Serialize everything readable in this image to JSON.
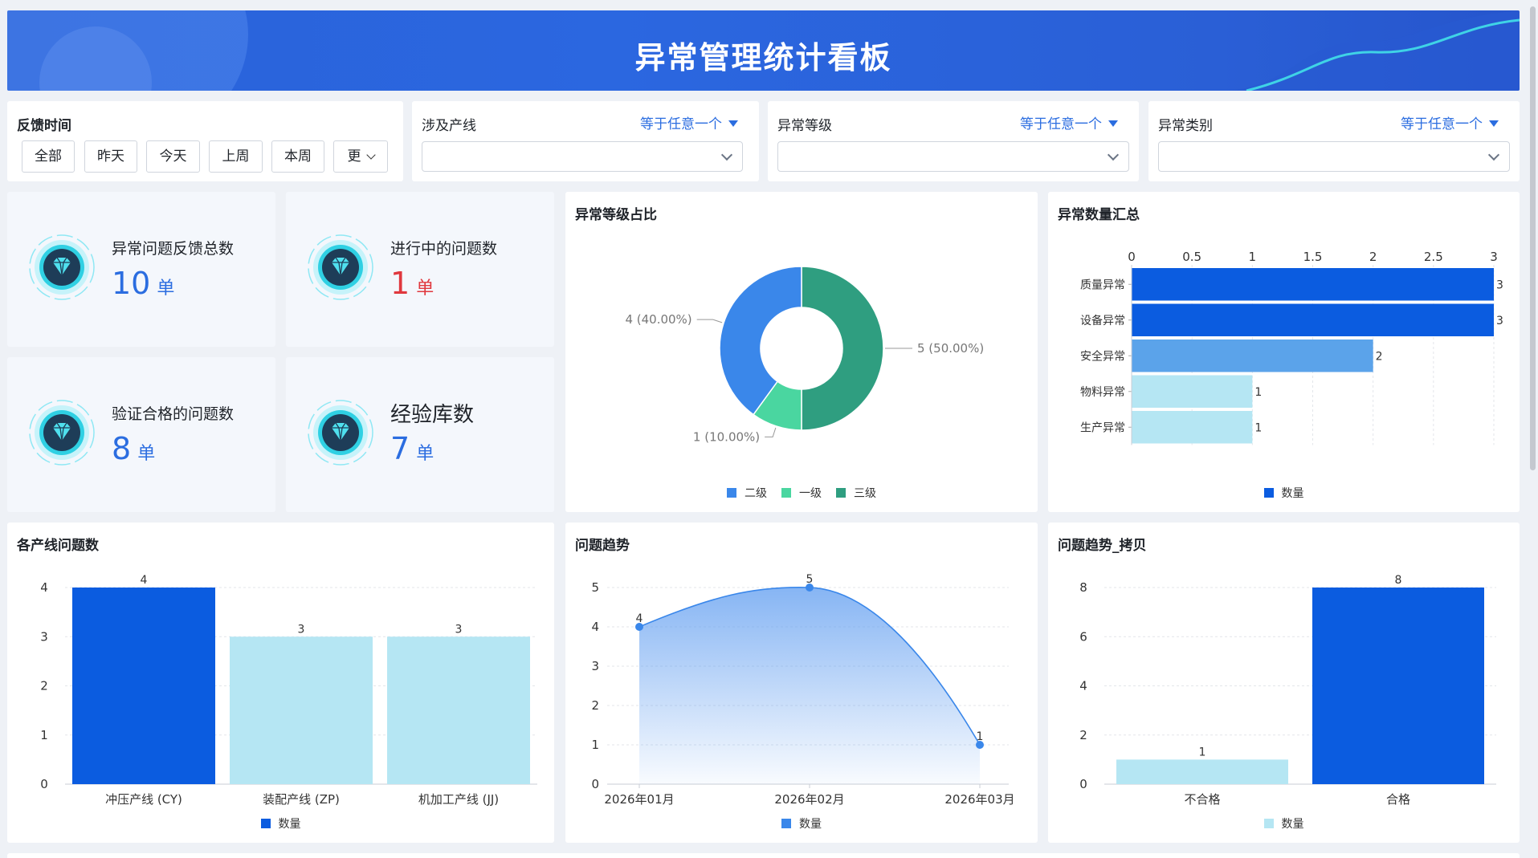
{
  "header": {
    "title": "异常管理统计看板"
  },
  "filters": {
    "time": {
      "label": "反馈时间",
      "buttons": [
        "全部",
        "昨天",
        "今天",
        "上周",
        "本周",
        "更"
      ]
    },
    "line": {
      "label": "涉及产线",
      "op": "等于任意一个",
      "value": ""
    },
    "level": {
      "label": "异常等级",
      "op": "等于任意一个",
      "value": ""
    },
    "category": {
      "label": "异常类别",
      "op": "等于任意一个",
      "value": ""
    }
  },
  "kpis": [
    {
      "label": "异常问题反馈总数",
      "value": "10",
      "unit": "单"
    },
    {
      "label": "进行中的问题数",
      "value": "1",
      "unit": "单"
    },
    {
      "label": "验证合格的问题数",
      "value": "8",
      "unit": "单"
    },
    {
      "label": "经验库数",
      "value": "7",
      "unit": "单"
    }
  ],
  "colors": {
    "accent": "#2b6de0",
    "red": "#e0383e",
    "dark_blue": "#0b5ce0",
    "mid_blue": "#5ba3ea",
    "light_blue": "#b5e6f3",
    "green": "#2f9e80",
    "mint": "#4ad6a0"
  },
  "chart_data": [
    {
      "id": "level-pie",
      "type": "pie",
      "title": "异常等级占比",
      "categories": [
        "二级",
        "一级",
        "三级"
      ],
      "values": [
        4,
        1,
        5
      ],
      "labels": [
        "4 (40.00%)",
        "1 (10.00%)",
        "5 (50.00%)"
      ],
      "colors": [
        "#3a87ea",
        "#4ad6a0",
        "#2f9e80"
      ],
      "legend": "bottom"
    },
    {
      "id": "category-bar",
      "type": "bar",
      "orientation": "horizontal",
      "title": "异常数量汇总",
      "categories": [
        "质量异常",
        "设备异常",
        "安全异常",
        "物料异常",
        "生产异常"
      ],
      "series": [
        {
          "name": "数量",
          "values": [
            3,
            3,
            2,
            1,
            1
          ]
        }
      ],
      "xlim": [
        0,
        3
      ],
      "xticks": [
        "0",
        "0.5",
        "1",
        "1.5",
        "2",
        "2.5",
        "3"
      ],
      "axis_position": "top",
      "grid": true,
      "legend": "bottom"
    },
    {
      "id": "line-bar",
      "type": "bar",
      "title": "各产线问题数",
      "categories": [
        "冲压产线 (CY)",
        "装配产线 (ZP)",
        "机加工产线 (JJ)"
      ],
      "series": [
        {
          "name": "数量",
          "values": [
            4,
            3,
            3
          ]
        }
      ],
      "ylim": [
        0,
        4
      ],
      "yticks": [
        "0",
        "1",
        "2",
        "3",
        "4"
      ],
      "grid": true,
      "legend": "bottom"
    },
    {
      "id": "trend-area",
      "type": "area",
      "title": "问题趋势",
      "categories": [
        "2026年01月",
        "2026年02月",
        "2026年03月"
      ],
      "series": [
        {
          "name": "数量",
          "values": [
            4,
            5,
            1
          ]
        }
      ],
      "ylim": [
        0,
        5
      ],
      "yticks": [
        "0",
        "1",
        "2",
        "3",
        "4",
        "5"
      ],
      "grid": true,
      "legend": "bottom"
    },
    {
      "id": "trend-copy-bar",
      "type": "bar",
      "title": "问题趋势_拷贝",
      "categories": [
        "不合格",
        "合格"
      ],
      "series": [
        {
          "name": "数量",
          "values": [
            1,
            8
          ]
        }
      ],
      "ylim": [
        0,
        8
      ],
      "yticks": [
        "0",
        "2",
        "4",
        "6",
        "8"
      ],
      "grid": true,
      "legend": "bottom"
    }
  ]
}
